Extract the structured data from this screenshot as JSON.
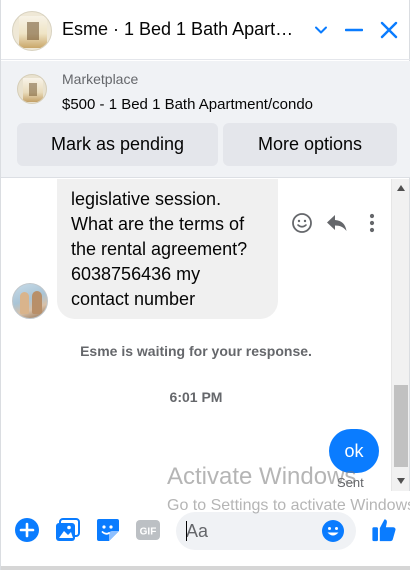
{
  "header": {
    "title": "Esme · 1 Bed 1 Bath Apart…",
    "avatar_icon": "listing-photo",
    "chevron_icon": "chevron-down-icon",
    "minimize_icon": "minimize-icon",
    "close_icon": "close-icon"
  },
  "marketplace": {
    "source": "Marketplace",
    "listing": "$500 - 1 Bed 1 Bath Apartment/condo",
    "mark_pending_label": "Mark as pending",
    "more_options_label": "More options"
  },
  "conversation": {
    "incoming_lines": [
      "legislative session.",
      "What are the terms of",
      "the rental agreement?",
      "6038756436 my",
      "contact number"
    ],
    "waiting_note": "Esme is waiting for your response.",
    "timestamp": "6:01 PM",
    "outgoing_message": "ok",
    "outgoing_status": "Sent"
  },
  "watermark": {
    "line1": "Activate Windows",
    "line2": "Go to Settings to activate Windows."
  },
  "composer": {
    "placeholder": "Aa"
  },
  "colors": {
    "accent": "#0a7cff",
    "bubble_incoming": "#f0f0f0",
    "bar_background": "#f0f2f5",
    "button_background": "#e4e6eb",
    "muted_text": "#65676b"
  }
}
